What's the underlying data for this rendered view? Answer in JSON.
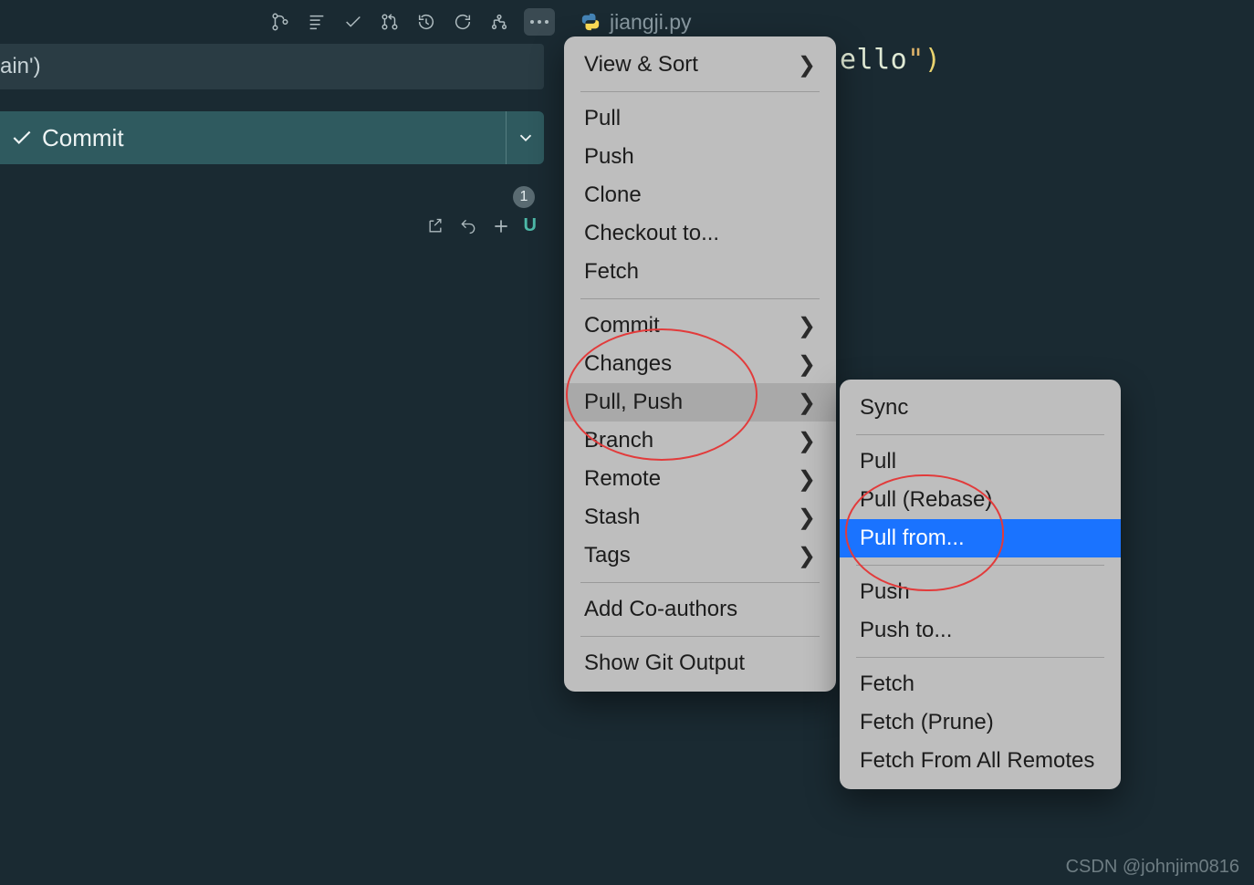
{
  "tab": {
    "filename": "jiangji.py"
  },
  "scm": {
    "input_text": "ain')",
    "commit_label": "Commit",
    "changes_badge": "1",
    "file_status": "U"
  },
  "editor": {
    "code_frag_pre": "ello",
    "code_frag_close": "\")"
  },
  "menu1": {
    "view_sort": "View & Sort",
    "pull": "Pull",
    "push": "Push",
    "clone": "Clone",
    "checkout": "Checkout to...",
    "fetch": "Fetch",
    "commit": "Commit",
    "changes": "Changes",
    "pull_push": "Pull, Push",
    "branch": "Branch",
    "remote": "Remote",
    "stash": "Stash",
    "tags": "Tags",
    "add_coauthors": "Add Co-authors",
    "show_git_output": "Show Git Output"
  },
  "menu2": {
    "sync": "Sync",
    "pull": "Pull",
    "pull_rebase": "Pull (Rebase)",
    "pull_from": "Pull from...",
    "push": "Push",
    "push_to": "Push to...",
    "fetch": "Fetch",
    "fetch_prune": "Fetch (Prune)",
    "fetch_all": "Fetch From All Remotes"
  },
  "watermark": "CSDN @johnjim0816"
}
